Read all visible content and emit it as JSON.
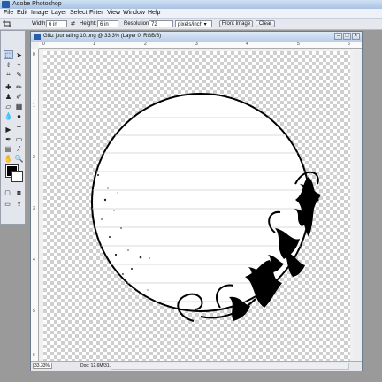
{
  "app": {
    "title": "Adobe Photoshop"
  },
  "menu": [
    "File",
    "Edit",
    "Image",
    "Layer",
    "Select",
    "Filter",
    "View",
    "Window",
    "Help"
  ],
  "options": {
    "width_label": "Width:",
    "width_value": "6 in",
    "height_label": "Height:",
    "height_value": "6 in",
    "resolution_label": "Resolution:",
    "resolution_value": "72",
    "resolution_unit": "pixels/inch",
    "front_image_button": "Front Image",
    "clear_button": "Clear"
  },
  "document": {
    "title": "Glitz journaling 10.png @ 33.3% (Layer 0, RGB/8)",
    "zoom": "33.33%",
    "doc_info": "Doc: 12.6M/31.2M",
    "ruler_h": [
      "0",
      "1",
      "2",
      "3",
      "4",
      "5",
      "6"
    ],
    "ruler_v": [
      "0",
      "1",
      "2",
      "3",
      "4",
      "5",
      "6"
    ]
  },
  "tools": [
    "marquee-tool",
    "move-tool",
    "lasso-tool",
    "magic-wand-tool",
    "crop-tool",
    "slice-tool",
    "healing-brush-tool",
    "brush-tool",
    "clone-stamp-tool",
    "history-brush-tool",
    "eraser-tool",
    "gradient-tool",
    "blur-tool",
    "dodge-tool",
    "path-selection-tool",
    "type-tool",
    "pen-tool",
    "shape-tool",
    "notes-tool",
    "eyedropper-tool",
    "hand-tool",
    "zoom-tool"
  ],
  "colors": {
    "foreground": "#000000",
    "background": "#ffffff"
  }
}
